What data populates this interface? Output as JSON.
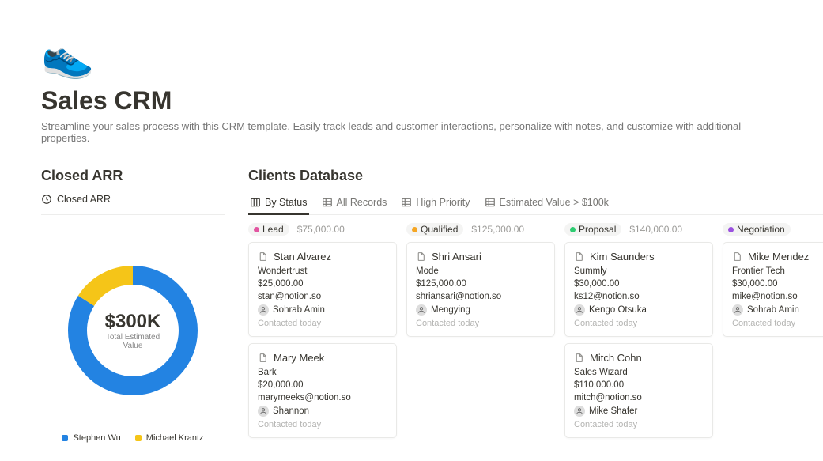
{
  "page_icon": "👟",
  "title": "Sales CRM",
  "subtitle": "Streamline your sales process with this CRM template. Easily track leads and customer interactions, personalize with notes, and customize with additional properties.",
  "closed_arr": {
    "section_title": "Closed ARR",
    "link_label": "Closed ARR",
    "total_value": "$300K",
    "total_label": "Total Estimated Value",
    "segments": [
      {
        "name": "Stephen Wu",
        "color": "#2383e2",
        "fraction": 0.84
      },
      {
        "name": "Michael Krantz",
        "color": "#f5c518",
        "fraction": 0.16
      }
    ]
  },
  "clients": {
    "section_title": "Clients Database",
    "tabs": [
      {
        "label": "By Status",
        "icon": "board",
        "active": true
      },
      {
        "label": "All Records",
        "icon": "table",
        "active": false
      },
      {
        "label": "High Priority",
        "icon": "table",
        "active": false
      },
      {
        "label": "Estimated Value > $100k",
        "icon": "table",
        "active": false
      }
    ],
    "contacted_label": "Contacted today",
    "columns": [
      {
        "status": "Lead",
        "sum": "$75,000.00",
        "dot": "#e255a1",
        "cards": [
          {
            "name": "Stan Alvarez",
            "company": "Wondertrust",
            "value": "$25,000.00",
            "email": "stan@notion.so",
            "owner": "Sohrab Amin"
          },
          {
            "name": "Mary Meek",
            "company": "Bark",
            "value": "$20,000.00",
            "email": "marymeeks@notion.so",
            "owner": "Shannon"
          }
        ]
      },
      {
        "status": "Qualified",
        "sum": "$125,000.00",
        "dot": "#f5a623",
        "cards": [
          {
            "name": "Shri Ansari",
            "company": "Mode",
            "value": "$125,000.00",
            "email": "shriansari@notion.so",
            "owner": "Mengying"
          }
        ]
      },
      {
        "status": "Proposal",
        "sum": "$140,000.00",
        "dot": "#2ecc71",
        "cards": [
          {
            "name": "Kim Saunders",
            "company": "Summly",
            "value": "$30,000.00",
            "email": "ks12@notion.so",
            "owner": "Kengo Otsuka"
          },
          {
            "name": "Mitch Cohn",
            "company": "Sales Wizard",
            "value": "$110,000.00",
            "email": "mitch@notion.so",
            "owner": "Mike Shafer"
          }
        ]
      },
      {
        "status": "Negotiation",
        "sum": "",
        "dot": "#9b51e0",
        "cards": [
          {
            "name": "Mike Mendez",
            "company": "Frontier Tech",
            "value": "$30,000.00",
            "email": "mike@notion.so",
            "owner": "Sohrab Amin"
          }
        ]
      }
    ]
  },
  "chart_data": {
    "type": "pie",
    "title": "Closed ARR",
    "categories": [
      "Stephen Wu",
      "Michael Krantz"
    ],
    "values": [
      252000,
      48000
    ],
    "total_label": "Total Estimated Value",
    "total": 300000
  }
}
